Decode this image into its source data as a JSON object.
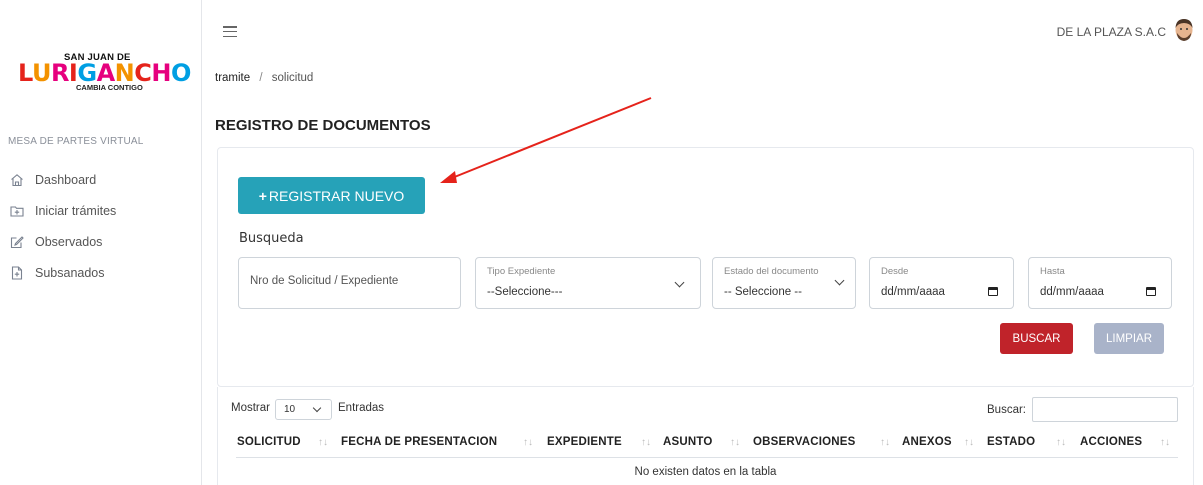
{
  "sidebar": {
    "logo": {
      "line1": "SAN JUAN DE",
      "line2": "LURIGANCHO",
      "line3": "CAMBIA CONTIGO"
    },
    "section_label": "MESA DE PARTES VIRTUAL",
    "items": [
      {
        "label": "Dashboard",
        "icon": "home-icon"
      },
      {
        "label": "Iniciar trámites",
        "icon": "folder-plus-icon"
      },
      {
        "label": "Observados",
        "icon": "edit-icon"
      },
      {
        "label": "Subsanados",
        "icon": "file-plus-icon"
      }
    ]
  },
  "topbar": {
    "user_name": "DE LA PLAZA S.A.C"
  },
  "breadcrumb": {
    "parent": "tramite",
    "separator": "/",
    "current": "solicitud"
  },
  "page_title": "REGISTRO DE DOCUMENTOS",
  "actions": {
    "register_new": "REGISTRAR NUEVO",
    "register_plus": "+"
  },
  "search": {
    "heading": "Busqueda",
    "nro_placeholder": "Nro de Solicitud / Expediente",
    "tipo_label": "Tipo Expediente",
    "tipo_value": "--Seleccione---",
    "estado_label": "Estado del documento",
    "estado_value": "-- Seleccione --",
    "desde_label": "Desde",
    "desde_value": "dd/mm/aaaa",
    "hasta_label": "Hasta",
    "hasta_value": "dd/mm/aaaa",
    "buscar_button": "BUSCAR",
    "limpiar_button": "LIMPIAR"
  },
  "table": {
    "show_label": "Mostrar",
    "page_length": "10",
    "entries_label": "Entradas",
    "search_label": "Buscar:",
    "columns": [
      "SOLICITUD",
      "FECHA DE PRESENTACION",
      "EXPEDIENTE",
      "ASUNTO",
      "OBSERVACIONES",
      "ANEXOS",
      "ESTADO",
      "ACCIONES"
    ],
    "empty_message": "No existen datos en la tabla"
  },
  "colors": {
    "primary": "#26a2b8",
    "danger": "#c0232a",
    "secondary": "#a9b3c9",
    "annotation_arrow": "#e5231b"
  }
}
